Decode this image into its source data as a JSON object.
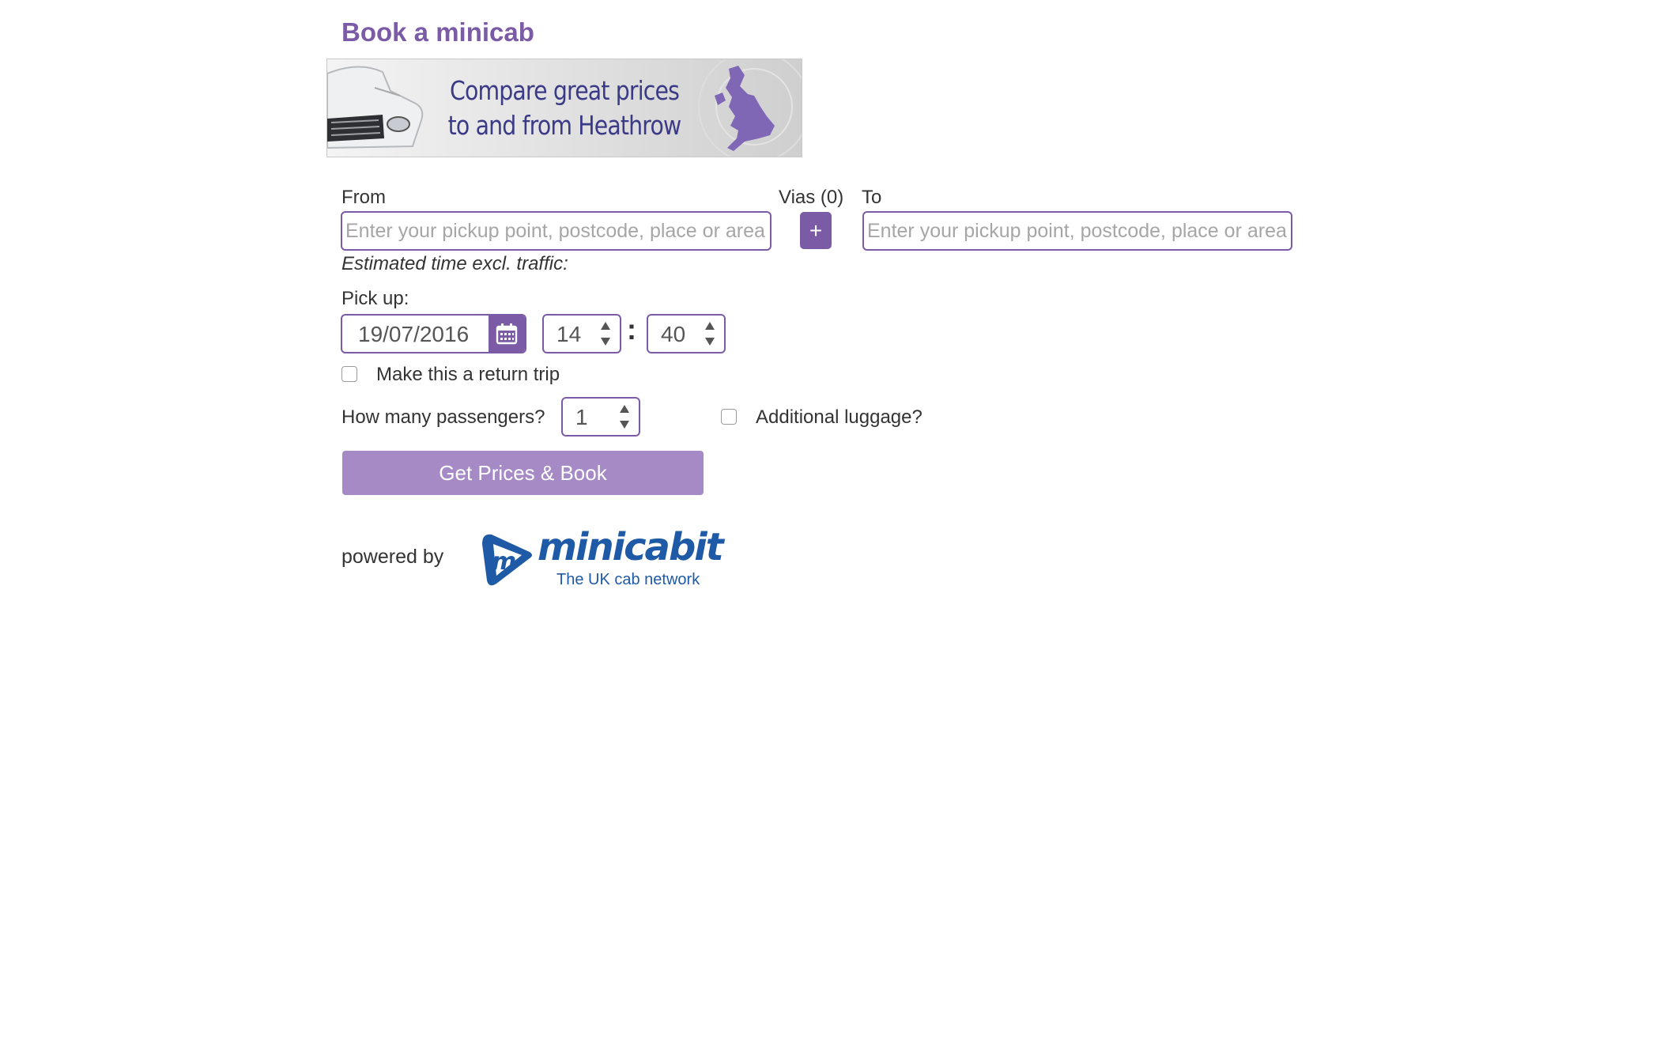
{
  "page": {
    "title": "Book a minicab"
  },
  "banner": {
    "line1": "Compare great prices",
    "line2": "to and from Heathrow"
  },
  "form": {
    "from_label": "From",
    "from_placeholder": "Enter your pickup point, postcode, place or area",
    "vias_label": "Vias (0)",
    "add_via_label": "+",
    "to_label": "To",
    "to_placeholder": "Enter your pickup point, postcode, place or area",
    "estimate_note": "Estimated time excl. traffic:",
    "pickup_label": "Pick up:",
    "date_value": "19/07/2016",
    "hour_value": "14",
    "minute_value": "40",
    "time_separator": ":",
    "return_trip_label": "Make this a return trip",
    "passengers_label": "How many passengers?",
    "passengers_value": "1",
    "luggage_label": "Additional luggage?",
    "submit_label": "Get Prices & Book"
  },
  "footer": {
    "powered_by": "powered by",
    "logo_word": "minicabit",
    "logo_tagline": "The UK cab network"
  },
  "colors": {
    "accent": "#7b5ba6",
    "button": "#a58ac5",
    "logo_blue": "#1f5aa6"
  }
}
